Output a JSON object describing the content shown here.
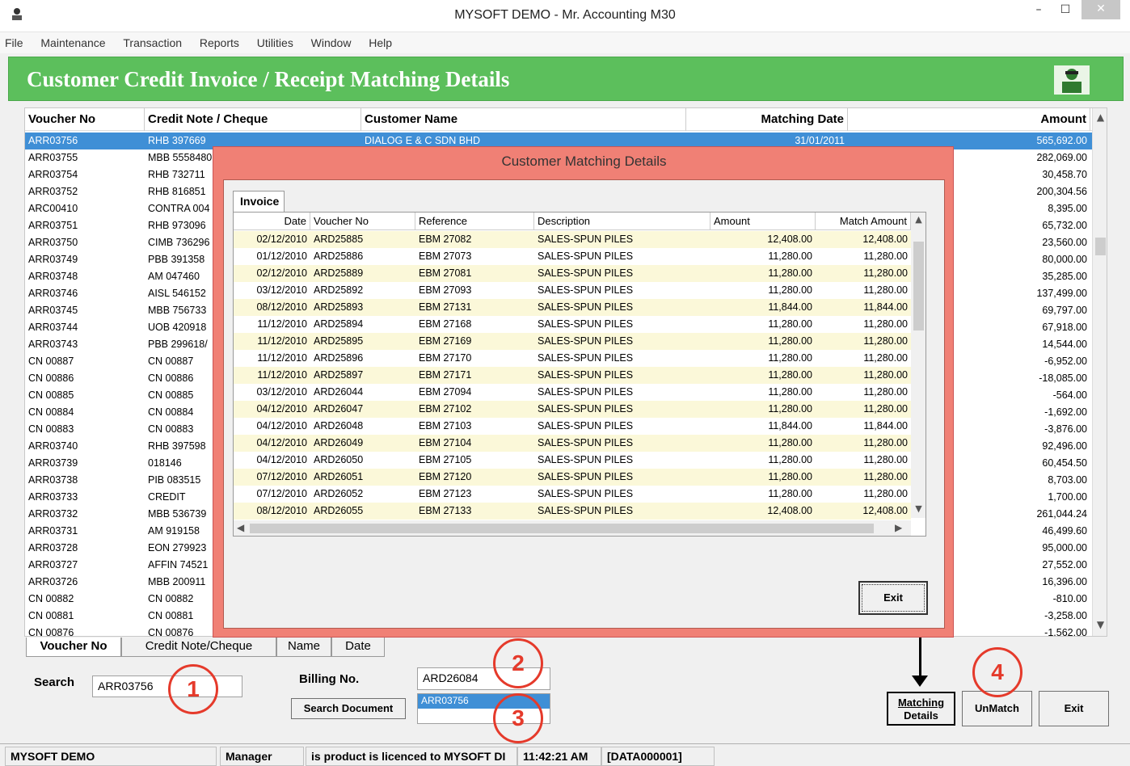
{
  "window": {
    "title": "MYSOFT DEMO - Mr. Accounting M30",
    "min": "–",
    "max": "☐",
    "close": "✕"
  },
  "menu": [
    "File",
    "Maintenance",
    "Transaction",
    "Reports",
    "Utilities",
    "Window",
    "Help"
  ],
  "header": {
    "title": "Customer Credit Invoice / Receipt  Matching Details",
    "color": "#5cbf5c"
  },
  "grid": {
    "columns": [
      "Voucher No",
      "Credit Note / Cheque",
      "Customer Name",
      "Matching Date",
      "Amount"
    ],
    "rows": [
      [
        "ARR03756",
        "RHB 397669",
        "DIALOG E & C SDN BHD",
        "31/01/2011",
        "565,692.00"
      ],
      [
        "ARR03755",
        "MBB 5558480",
        "",
        "",
        "282,069.00"
      ],
      [
        "ARR03754",
        "RHB 732711",
        "",
        "",
        "30,458.70"
      ],
      [
        "ARR03752",
        "RHB 816851",
        "",
        "",
        "200,304.56"
      ],
      [
        "ARC00410",
        "CONTRA 004",
        "",
        "",
        "8,395.00"
      ],
      [
        "ARR03751",
        "RHB 973096",
        "",
        "",
        "65,732.00"
      ],
      [
        "ARR03750",
        "CIMB 736296",
        "",
        "",
        "23,560.00"
      ],
      [
        "ARR03749",
        "PBB 391358",
        "",
        "",
        "80,000.00"
      ],
      [
        "ARR03748",
        "AM 047460",
        "",
        "",
        "35,285.00"
      ],
      [
        "ARR03746",
        "AISL 546152",
        "",
        "",
        "137,499.00"
      ],
      [
        "ARR03745",
        "MBB 756733",
        "",
        "",
        "69,797.00"
      ],
      [
        "ARR03744",
        "UOB 420918",
        "",
        "",
        "67,918.00"
      ],
      [
        "ARR03743",
        "PBB 299618/",
        "",
        "",
        "14,544.00"
      ],
      [
        "CN 00887",
        "CN 00887",
        "",
        "",
        "-6,952.00"
      ],
      [
        "CN 00886",
        "CN 00886",
        "",
        "",
        "-18,085.00"
      ],
      [
        "CN 00885",
        "CN 00885",
        "",
        "",
        "-564.00"
      ],
      [
        "CN 00884",
        "CN 00884",
        "",
        "",
        "-1,692.00"
      ],
      [
        "CN 00883",
        "CN 00883",
        "",
        "",
        "-3,876.00"
      ],
      [
        "ARR03740",
        "RHB 397598",
        "",
        "",
        "92,496.00"
      ],
      [
        "ARR03739",
        "018146",
        "",
        "",
        "60,454.50"
      ],
      [
        "ARR03738",
        "PIB 083515",
        "",
        "",
        "8,703.00"
      ],
      [
        "ARR03733",
        "CREDIT",
        "",
        "",
        "1,700.00"
      ],
      [
        "ARR03732",
        "MBB 536739",
        "",
        "",
        "261,044.24"
      ],
      [
        "ARR03731",
        "AM 919158",
        "",
        "",
        "46,499.60"
      ],
      [
        "ARR03728",
        "EON 279923",
        "",
        "",
        "95,000.00"
      ],
      [
        "ARR03727",
        "AFFIN 74521",
        "",
        "",
        "27,552.00"
      ],
      [
        "ARR03726",
        "MBB 200911",
        "",
        "",
        "16,396.00"
      ],
      [
        "CN 00882",
        "CN 00882",
        "",
        "",
        "-810.00"
      ],
      [
        "CN 00881",
        "CN 00881",
        "",
        "",
        "-3,258.00"
      ],
      [
        "CN 00876",
        "CN 00876",
        "",
        "",
        "-1,562.00"
      ]
    ]
  },
  "tabs": [
    "Voucher No",
    "Credit Note/Cheque",
    "Name",
    "Date"
  ],
  "search": {
    "label": "Search",
    "value": "ARR03756"
  },
  "billing": {
    "label": "Billing No.",
    "value": "ARD26084",
    "list_selected": "ARR03756"
  },
  "buttons": {
    "search_document": "Search Document",
    "matching_details_1": "Matching",
    "matching_details_2": "Details",
    "unmatch": "UnMatch",
    "exit": "Exit"
  },
  "callouts": [
    "1",
    "2",
    "3",
    "4"
  ],
  "dialog": {
    "title": "Customer Matching Details",
    "tab": "Invoice",
    "columns": [
      "Date",
      "Voucher No",
      "Reference",
      "Description",
      "Amount",
      "Match Amount"
    ],
    "rows": [
      [
        "02/12/2010",
        "ARD25885",
        "EBM 27082",
        "SALES-SPUN PILES",
        "12,408.00",
        "12,408.00"
      ],
      [
        "01/12/2010",
        "ARD25886",
        "EBM 27073",
        "SALES-SPUN PILES",
        "11,280.00",
        "11,280.00"
      ],
      [
        "02/12/2010",
        "ARD25889",
        "EBM 27081",
        "SALES-SPUN PILES",
        "11,280.00",
        "11,280.00"
      ],
      [
        "03/12/2010",
        "ARD25892",
        "EBM 27093",
        "SALES-SPUN PILES",
        "11,280.00",
        "11,280.00"
      ],
      [
        "08/12/2010",
        "ARD25893",
        "EBM 27131",
        "SALES-SPUN PILES",
        "11,844.00",
        "11,844.00"
      ],
      [
        "11/12/2010",
        "ARD25894",
        "EBM 27168",
        "SALES-SPUN PILES",
        "11,280.00",
        "11,280.00"
      ],
      [
        "11/12/2010",
        "ARD25895",
        "EBM 27169",
        "SALES-SPUN PILES",
        "11,280.00",
        "11,280.00"
      ],
      [
        "11/12/2010",
        "ARD25896",
        "EBM 27170",
        "SALES-SPUN PILES",
        "11,280.00",
        "11,280.00"
      ],
      [
        "11/12/2010",
        "ARD25897",
        "EBM 27171",
        "SALES-SPUN PILES",
        "11,280.00",
        "11,280.00"
      ],
      [
        "03/12/2010",
        "ARD26044",
        "EBM 27094",
        "SALES-SPUN PILES",
        "11,280.00",
        "11,280.00"
      ],
      [
        "04/12/2010",
        "ARD26047",
        "EBM 27102",
        "SALES-SPUN PILES",
        "11,280.00",
        "11,280.00"
      ],
      [
        "04/12/2010",
        "ARD26048",
        "EBM 27103",
        "SALES-SPUN PILES",
        "11,844.00",
        "11,844.00"
      ],
      [
        "04/12/2010",
        "ARD26049",
        "EBM 27104",
        "SALES-SPUN PILES",
        "11,280.00",
        "11,280.00"
      ],
      [
        "04/12/2010",
        "ARD26050",
        "EBM 27105",
        "SALES-SPUN PILES",
        "11,280.00",
        "11,280.00"
      ],
      [
        "07/12/2010",
        "ARD26051",
        "EBM 27120",
        "SALES-SPUN PILES",
        "11,280.00",
        "11,280.00"
      ],
      [
        "07/12/2010",
        "ARD26052",
        "EBM 27123",
        "SALES-SPUN PILES",
        "11,280.00",
        "11,280.00"
      ],
      [
        "08/12/2010",
        "ARD26055",
        "EBM 27133",
        "SALES-SPUN PILES",
        "12,408.00",
        "12,408.00"
      ]
    ],
    "exit": "Exit"
  },
  "status": [
    "MYSOFT DEMO",
    "Manager",
    "is product is licenced to MYSOFT DI",
    "11:42:21 AM",
    "[DATA000001]"
  ]
}
